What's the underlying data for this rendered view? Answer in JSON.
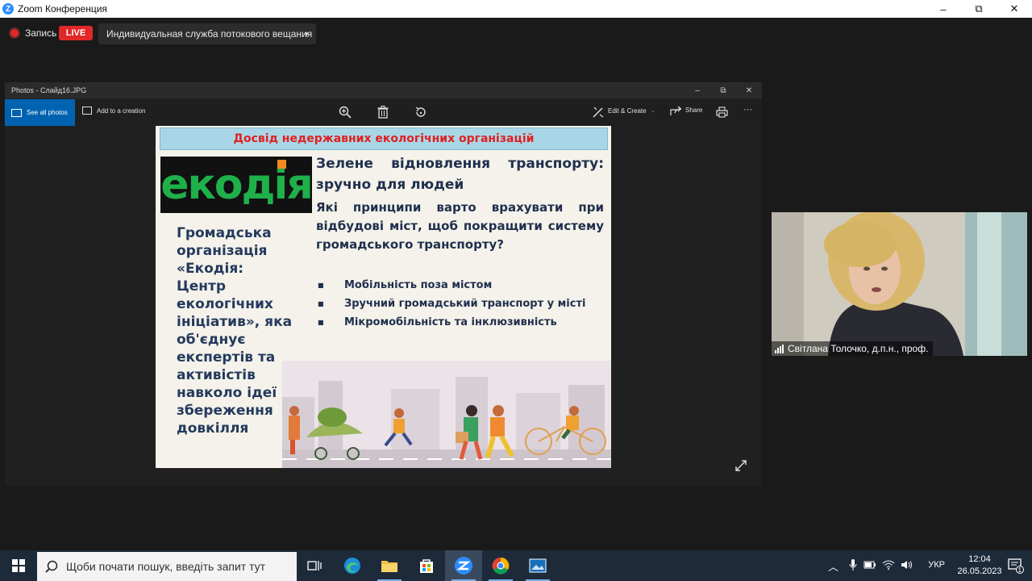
{
  "zoom": {
    "window_title": "Zoom Конференция",
    "logo_letter": "Z",
    "minimize": "–",
    "maximize": "⧉",
    "close": "✕",
    "record_label": "Запись",
    "live_badge": "LIVE",
    "stream_service": "Индивидуальная служба потокового вещания",
    "stream_caret": "▼"
  },
  "photos": {
    "window_title": "Photos - Слайд16.JPG",
    "minimize": "–",
    "restore": "⧉",
    "close": "✕",
    "see_all": "See all photos",
    "add_to_creation": "Add to a creation",
    "edit_create": "Edit & Create",
    "share": "Share",
    "more": "···"
  },
  "slide": {
    "header": "Досвід недержавних екологічних організацій",
    "logo": "екодія",
    "org_description": "Громадська організація «Екодія: Центр екологічних ініціатив», яка об'єднує експертів та активістів навколо ідеї збереження довкілля",
    "heading": "Зелене відновлення транспорту: зручно для людей",
    "question": "Які принципи варто врахувати при відбудові міст, щоб покращити систему громадського транспорту?",
    "bullets": [
      "Мобільність поза містом",
      "Зручний громадський транспорт у місті",
      "Мікромобільність та інклюзивність"
    ]
  },
  "video": {
    "participant_name": "Світлана Толочко, д.п.н., проф."
  },
  "taskbar": {
    "search_placeholder": "Щоби почати пошук, введіть запит тут",
    "language": "УКР",
    "time": "12:04",
    "date": "26.05.2023",
    "notification_count": "1"
  },
  "colors": {
    "zoom_blue": "#2d8cff",
    "live_red": "#e02828",
    "photos_accent": "#0063b1",
    "slide_header_text": "#e02020",
    "logo_green": "#1fb04a",
    "logo_orange": "#f08a1d"
  }
}
